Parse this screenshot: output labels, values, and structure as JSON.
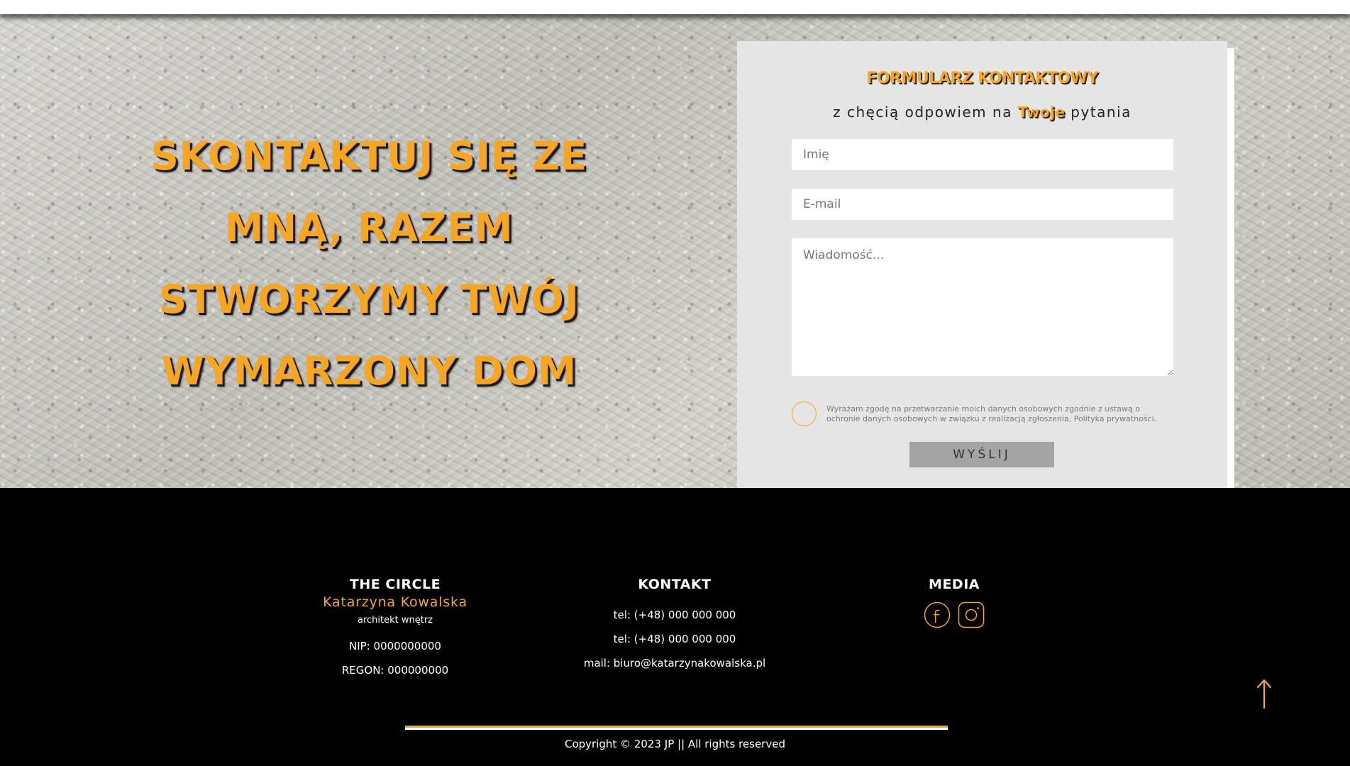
{
  "hero": {
    "heading": "SKONTAKTUJ SIĘ ZE MNĄ, RAZEM STWORZYMY TWÓJ WYMARZONY DOM"
  },
  "contact_form": {
    "title": "FORMULARZ KONTAKTOWY",
    "subtitle_before": "z chęcią odpowiem na ",
    "subtitle_accent": "Twoje",
    "subtitle_after": " pytania",
    "name_placeholder": "Imię",
    "email_placeholder": "E-mail",
    "message_placeholder": "Wiadomość...",
    "consent_text": "Wyrażam zgodę na przetwarzanie moich danych osobowych zgodnie z ustawą o ochronie danych osobowych w związku z realizacją zgłoszenia, Polityka prywatności.",
    "submit_label": "WYŚLIJ"
  },
  "footer": {
    "company": {
      "title": "THE CIRCLE",
      "name": "Katarzyna Kowalska",
      "role": "architekt wnętrz",
      "nip": "NIP: 0000000000",
      "regon": "REGON: 000000000"
    },
    "contact": {
      "title": "KONTAKT",
      "phone_1": "tel: (+48) 000 000 000",
      "phone_2": "tel: (+48) 000 000 000",
      "mail": "mail: biuro@katarzynakowalska.pl"
    },
    "media": {
      "title": "MEDIA",
      "icons": [
        "facebook-icon",
        "instagram-icon"
      ]
    },
    "copyright": "Copyright © 2023 JP || All rights reserved",
    "to_top_icon": "arrow-up-icon"
  },
  "colors": {
    "accent": "#f5a623",
    "card_bg": "#e5e5e5",
    "footer_bg": "#000000",
    "button_bg": "#a4a4a4"
  }
}
